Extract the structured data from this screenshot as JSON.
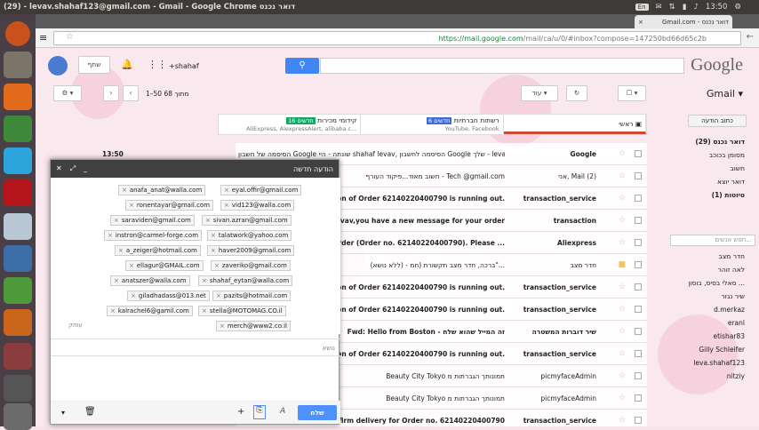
{
  "window": {
    "title": "(29) - levav.shahaf123@gmail.com - Gmail - Google Chrome דואר נכנס",
    "time": "13:50",
    "lang": "En"
  },
  "tab": {
    "label": "Gmail.com - דואר נכנס",
    "close": "×"
  },
  "url": {
    "scheme": "https://",
    "host": "mail.google.com",
    "path": "/mail/ca/u/0/#inbox?compose=147250bd66d65c2b"
  },
  "header": {
    "logo": "Google",
    "plus_user": "+shahaf",
    "share": "שתף",
    "gmail_label": "Gmail ▾",
    "search_icon": "search-icon"
  },
  "toolbar": {
    "more": "עוד",
    "range": "1–50 מתוך 68",
    "more_icon": "more-icon"
  },
  "categories": [
    {
      "label": "ראשי",
      "badge": "",
      "sub": ""
    },
    {
      "label": "רשתות חברתיות",
      "badge": "6 חדשים",
      "sub": "YouTube, Facebook",
      "color": "#3f6ad8"
    },
    {
      "label": "קידומי מכירות",
      "badge": "16 חדשים",
      "sub": "AliExpress, AlexpressAlert, alibaba.c...",
      "color": "#16a765"
    }
  ],
  "sidebar": {
    "compose": "כתוב הודעה",
    "items": [
      "דואר נכנס (29)",
      "מסומן בכוכב",
      "חשוב",
      "דואר יוצא",
      "טיוטות (1)"
    ],
    "chat_search": "חפש אנשים...",
    "contacts": [
      "חדר מצב",
      "לאה זוהר",
      "סאלי בסיס, בוסון ...",
      "שיר נגזר",
      "d.merkaz",
      "eranl",
      "etishar83",
      "Gilly Schleifer",
      "leva.shahaf123",
      "nitziy"
    ]
  },
  "emails": [
    {
      "sender": "Google",
      "subject": "הסיסמה של חשבון Google שונתה - היי shahaf levav, הסיסמה לחשבון Google שלך - levav.shahaf123@gmail.com",
      "time": "13:50"
    },
    {
      "sender": "אני, Mail (2)",
      "subject": "חשוב מאוד...פיקוד העורף - Tech @gmail.com",
      "time": ""
    },
    {
      "sender": "transaction_service",
      "subject": "on of Order 62140220400790 is running out.",
      "time": ""
    },
    {
      "sender": "transaction",
      "subject": "vav,you have a new message for your order",
      "time": ""
    },
    {
      "sender": "Aliexpress",
      "subject": "order (Order no. 62140220400790). Please ...",
      "time": ""
    },
    {
      "sender": "חדר מצב",
      "subject": "(ללא נושא) - ברכה, חדר מצב תקשורת (חמ\"...",
      "time": ""
    },
    {
      "sender": "transaction_service",
      "subject": "on of Order 62140220400790 is running out.",
      "time": ""
    },
    {
      "sender": "transaction_service",
      "subject": "on of Order 62140220400790 is running out.",
      "time": ""
    },
    {
      "sender": "שיר דוברות המשטרה",
      "subject": "Fwd: Hello from Boston - זה המייל שהוא שלח",
      "time": ""
    },
    {
      "sender": "transaction_service",
      "subject": "on of Order 62140220400790 is running out.",
      "time": ""
    },
    {
      "sender": "picmyfaceAdmin",
      "subject": "Beauty City Tokyo תמונותך הגברתות מ",
      "time": ""
    },
    {
      "sender": "picmyfaceAdmin",
      "subject": "Beauty City Tokyo תמונותך הגברתות מ",
      "time": ""
    },
    {
      "sender": "transaction_service",
      "subject": "nfirm delivery for Order no. 62140220400790",
      "time": ""
    }
  ],
  "compose": {
    "title": "הודעה חדשה",
    "recipients": [
      "eyal.offir@gmail.com",
      "anafa_anat@walla.com",
      "vid123@walla.com",
      "ronentayar@gmail.com",
      "sivan.azran@gmail.com",
      "saraviden@gmail.com",
      "talatwork@yahoo.com",
      "instron@carmel-forge.com",
      "haver2009@gmail.com",
      "a_zeiger@hotmail.com",
      "zaveriko@gmail.com",
      "ellagur@GMAIL.com",
      "shahaf_eytan@walla.com",
      "anatszer@walla.com",
      "pazits@hotmail.com",
      "giladhadass@013.net",
      "stella@MOTOMAG.CO.il",
      "kalrachel6@gamil.com",
      "merch@www2.co.il"
    ],
    "copy_label": "עותק",
    "subject_placeholder": "נושא",
    "send": "שלח"
  }
}
